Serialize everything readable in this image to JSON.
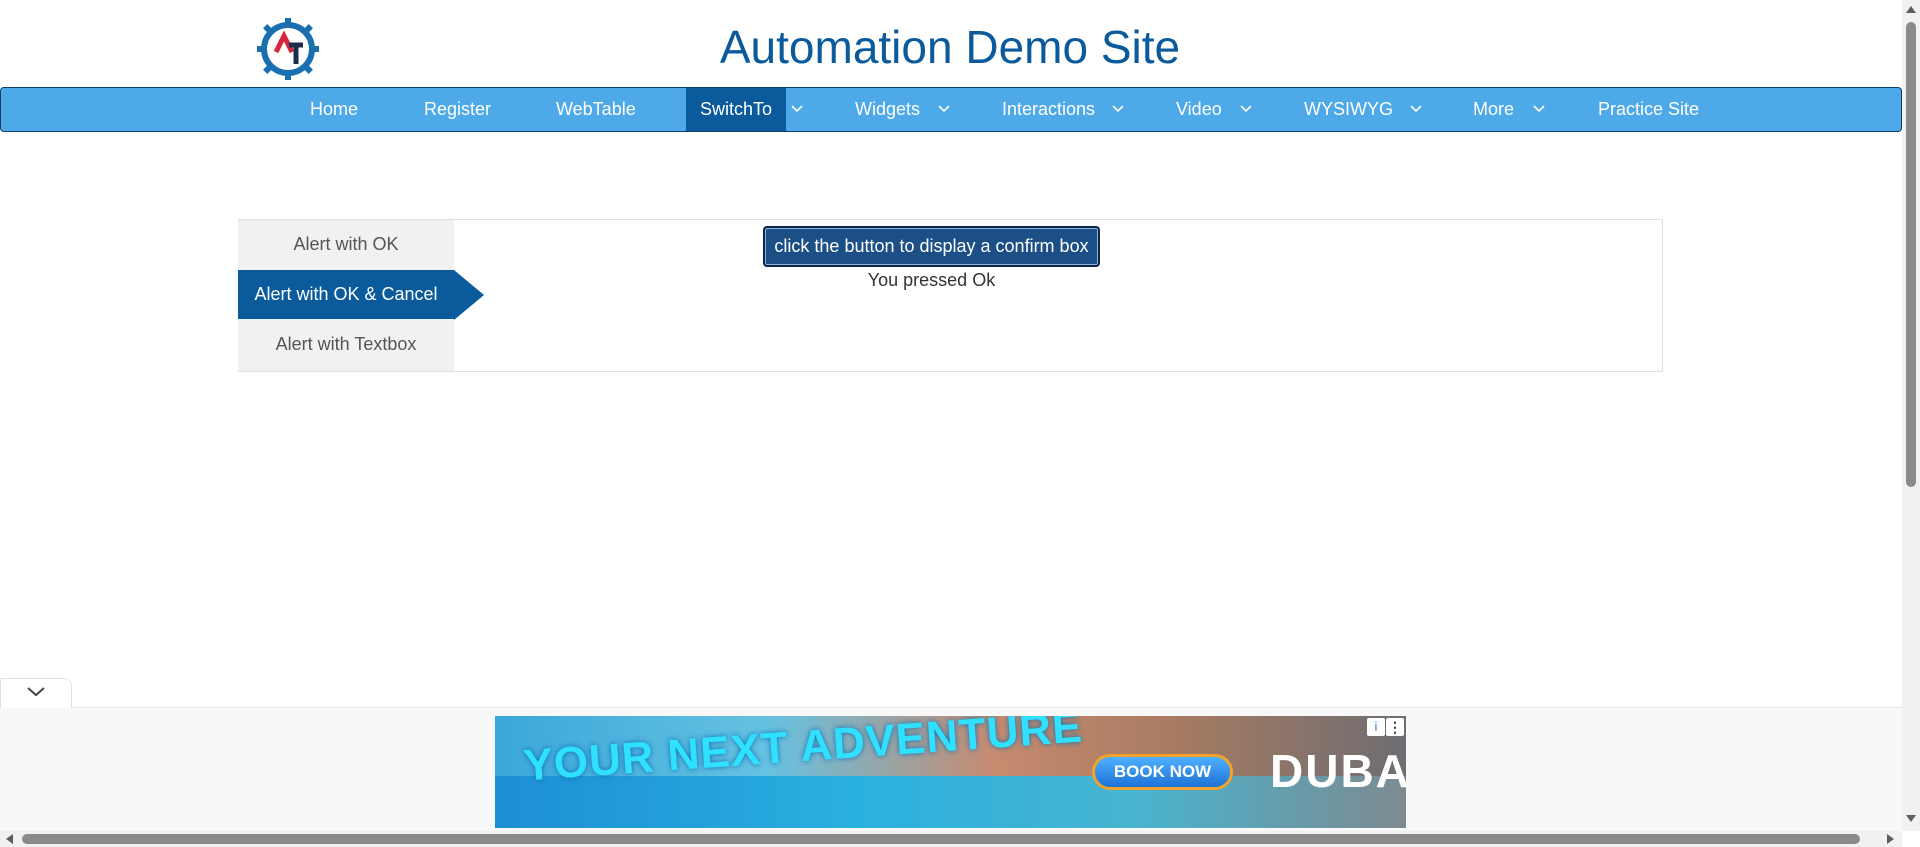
{
  "header": {
    "logo_icon": "automation-gear-logo-icon",
    "logo_letters": "AT",
    "title": "Automation Demo Site"
  },
  "nav": {
    "items": [
      {
        "label": "Home",
        "dropdown": false,
        "active": false
      },
      {
        "label": "Register",
        "dropdown": false,
        "active": false
      },
      {
        "label": "WebTable",
        "dropdown": false,
        "active": false
      },
      {
        "label": "SwitchTo",
        "dropdown": true,
        "active": true
      },
      {
        "label": "Widgets",
        "dropdown": true,
        "active": false
      },
      {
        "label": "Interactions",
        "dropdown": true,
        "active": false
      },
      {
        "label": "Video",
        "dropdown": true,
        "active": false
      },
      {
        "label": "WYSIWYG",
        "dropdown": true,
        "active": false
      },
      {
        "label": "More",
        "dropdown": true,
        "active": false
      },
      {
        "label": "Practice Site",
        "dropdown": false,
        "active": false
      }
    ],
    "caret_icon": "chevron-down-icon"
  },
  "alerts": {
    "tabs": [
      {
        "label": "Alert with OK",
        "active": false
      },
      {
        "label": "Alert with OK & Cancel",
        "active": true
      },
      {
        "label": "Alert with Textbox",
        "active": false
      }
    ],
    "confirm_button_label": "click the button to display a confirm box",
    "result_text": "You pressed Ok"
  },
  "ad": {
    "collapse_icon": "chevron-down-icon",
    "headline": "YOUR NEXT ADVENTURE",
    "cta_label": "BOOK NOW",
    "brand": "DUBAI",
    "info_icon": "info-icon",
    "menu_icon": "kebab-menu-icon"
  },
  "colors": {
    "nav_bg": "#4da9e8",
    "active_bg": "#0a5a9c",
    "title": "#0a5a9c",
    "button_bg": "#1b4f85"
  }
}
